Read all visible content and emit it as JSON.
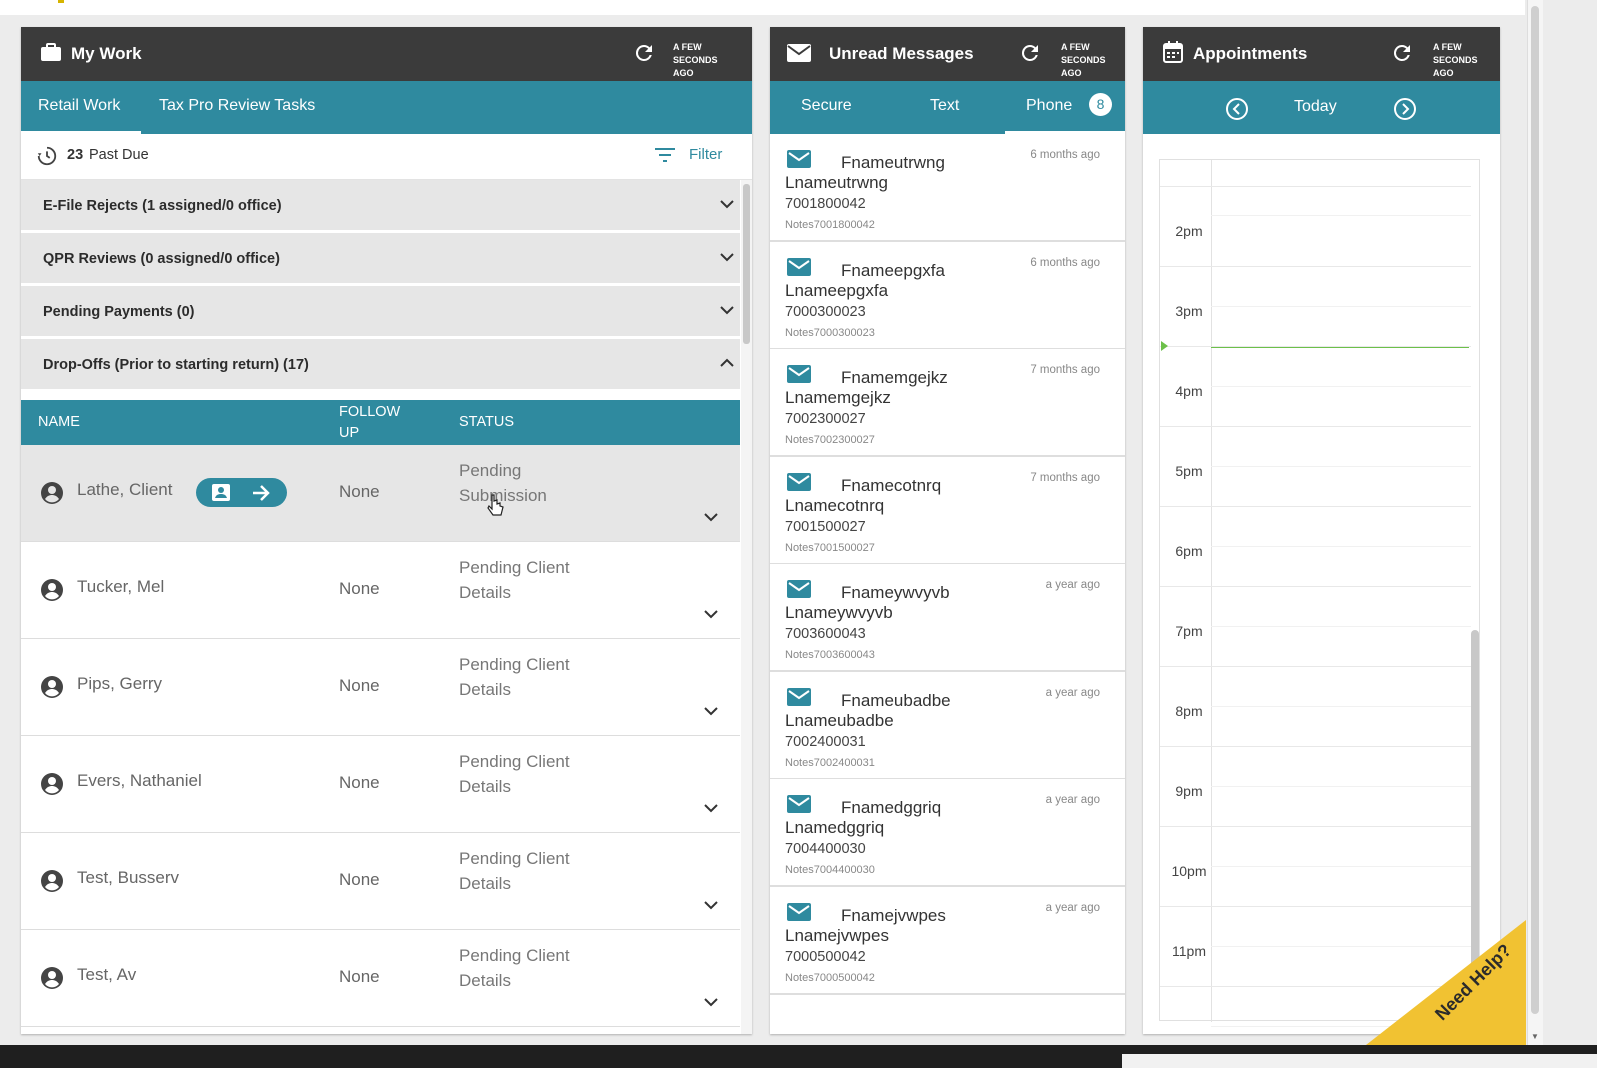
{
  "colors": {
    "teal": "#2f8a9f",
    "header": "#3b3b3b",
    "now_line": "#6cc04a",
    "help": "#f1c232"
  },
  "my_work": {
    "title": "My Work",
    "icon": "briefcase-icon",
    "refresh_stamp": [
      "A FEW",
      "SECONDS",
      "AGO"
    ],
    "tabs": [
      {
        "label": "Retail Work",
        "active": true
      },
      {
        "label": "Tax Pro Review Tasks",
        "active": false
      }
    ],
    "past_due": {
      "count": "23",
      "label": "Past Due"
    },
    "filter_label": "Filter",
    "sections": [
      {
        "label": "E-File Rejects (1 assigned/0 office)",
        "expanded": false
      },
      {
        "label": "QPR Reviews (0 assigned/0 office)",
        "expanded": false
      },
      {
        "label": "Pending Payments (0)",
        "expanded": false
      },
      {
        "label": "Drop-Offs (Prior to starting return) (17)",
        "expanded": true
      }
    ],
    "table": {
      "headers": {
        "name": "NAME",
        "follow_up": [
          "FOLLOW",
          "UP"
        ],
        "status": "STATUS"
      },
      "rows": [
        {
          "name": "Lathe, Client",
          "follow_up": "None",
          "status": [
            "Pending",
            "Submission"
          ],
          "highlighted": true
        },
        {
          "name": "Tucker, Mel",
          "follow_up": "None",
          "status": [
            "Pending Client",
            "Details"
          ]
        },
        {
          "name": "Pips, Gerry",
          "follow_up": "None",
          "status": [
            "Pending Client",
            "Details"
          ]
        },
        {
          "name": "Evers, Nathaniel",
          "follow_up": "None",
          "status": [
            "Pending Client",
            "Details"
          ]
        },
        {
          "name": "Test, Busserv",
          "follow_up": "None",
          "status": [
            "Pending Client",
            "Details"
          ]
        },
        {
          "name": "Test, Av",
          "follow_up": "None",
          "status": [
            "Pending Client",
            "Details"
          ]
        }
      ]
    }
  },
  "messages": {
    "title": "Unread Messages",
    "icon": "envelope-icon",
    "refresh_stamp": [
      "A FEW",
      "SECONDS",
      "AGO"
    ],
    "tabs": [
      {
        "label": "Secure"
      },
      {
        "label": "Text"
      },
      {
        "label": "Phone",
        "active": true,
        "badge": "8"
      }
    ],
    "items": [
      {
        "first": "Fnameutrwng",
        "last": "Lnameutrwng",
        "phone": "7001800042",
        "notes": "Notes7001800042",
        "time": "6 months ago"
      },
      {
        "first": "Fnameepgxfa",
        "last": "Lnameepgxfa",
        "phone": "7000300023",
        "notes": "Notes7000300023",
        "time": "6 months ago"
      },
      {
        "first": "Fnamemgejkz",
        "last": "Lnamemgejkz",
        "phone": "7002300027",
        "notes": "Notes7002300027",
        "time": "7 months ago"
      },
      {
        "first": "Fnamecotnrq",
        "last": "Lnamecotnrq",
        "phone": "7001500027",
        "notes": "Notes7001500027",
        "time": "7 months ago"
      },
      {
        "first": "Fnameywvyvb",
        "last": "Lnameywvyvb",
        "phone": "7003600043",
        "notes": "Notes7003600043",
        "time": "a year ago"
      },
      {
        "first": "Fnameubadbe",
        "last": "Lnameubadbe",
        "phone": "7002400031",
        "notes": "Notes7002400031",
        "time": "a year ago"
      },
      {
        "first": "Fnamedggriq",
        "last": "Lnamedggriq",
        "phone": "7004400030",
        "notes": "Notes7004400030",
        "time": "a year ago"
      },
      {
        "first": "Fnamejvwpes",
        "last": "Lnamejvwpes",
        "phone": "7000500042",
        "notes": "Notes7000500042",
        "time": "a year ago"
      }
    ]
  },
  "appointments": {
    "title": "Appointments",
    "icon": "calendar-icon",
    "refresh_stamp": [
      "A FEW",
      "SECONDS",
      "AGO"
    ],
    "nav_label": "Today",
    "hours": [
      "2pm",
      "3pm",
      "4pm",
      "5pm",
      "6pm",
      "7pm",
      "8pm",
      "9pm",
      "10pm",
      "11pm"
    ]
  },
  "help_label": "Need Help?"
}
